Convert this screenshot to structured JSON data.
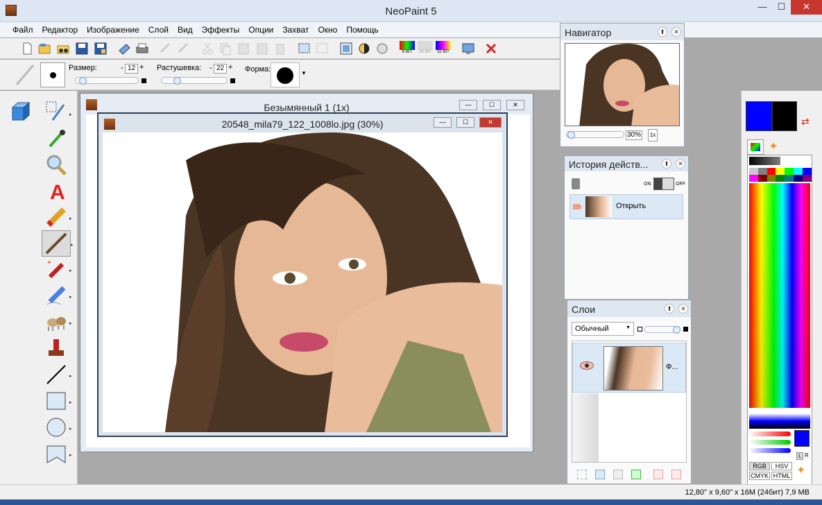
{
  "app": {
    "title": "NeoPaint 5"
  },
  "window_controls": {
    "minimize": "—",
    "maximize": "☐",
    "close": "✕"
  },
  "menu": [
    "Файл",
    "Редактор",
    "Изображение",
    "Слой",
    "Вид",
    "Эффекты",
    "Опции",
    "Захват",
    "Окно",
    "Помощь"
  ],
  "toolbar": {
    "bit8": "8 BIT",
    "bit24": "24 BIT",
    "bit32": "32 BIT"
  },
  "options": {
    "size_label": "Размер:",
    "size_value": "12",
    "feather_label": "Растушевка:",
    "feather_value": "22",
    "shape_label": "Форма:",
    "minus": "-",
    "plus": "+"
  },
  "documents": {
    "back_title": "Безымянный 1 (1x)",
    "front_title": "20548_mila79_122_1008lo.jpg (30%)"
  },
  "navigator": {
    "title": "Навигатор",
    "zoom": "30%",
    "one_x": "1x"
  },
  "history": {
    "title": "История действ...",
    "on": "ON",
    "off": "OFF",
    "items": [
      "Открыть"
    ]
  },
  "layers": {
    "title": "Слои",
    "blend_mode": "Обычный",
    "layer_name": "Ф..."
  },
  "colors": {
    "primary": "#0000ff",
    "secondary": "#000000",
    "modes": [
      "RGB",
      "HSV",
      "CMYK",
      "HTML"
    ],
    "l_label": "L",
    "r_label": "R",
    "swatches": [
      "#c8c8c8",
      "#808080",
      "#ff0000",
      "#ffff00",
      "#00ff00",
      "#00ffff",
      "#0000ff",
      "#ff00ff",
      "#800000",
      "#808000",
      "#008000",
      "#008080",
      "#000080",
      "#800080"
    ]
  },
  "status": {
    "text": "12,80\" x 9,60\" x 16M (24бит) 7,9 MB"
  }
}
